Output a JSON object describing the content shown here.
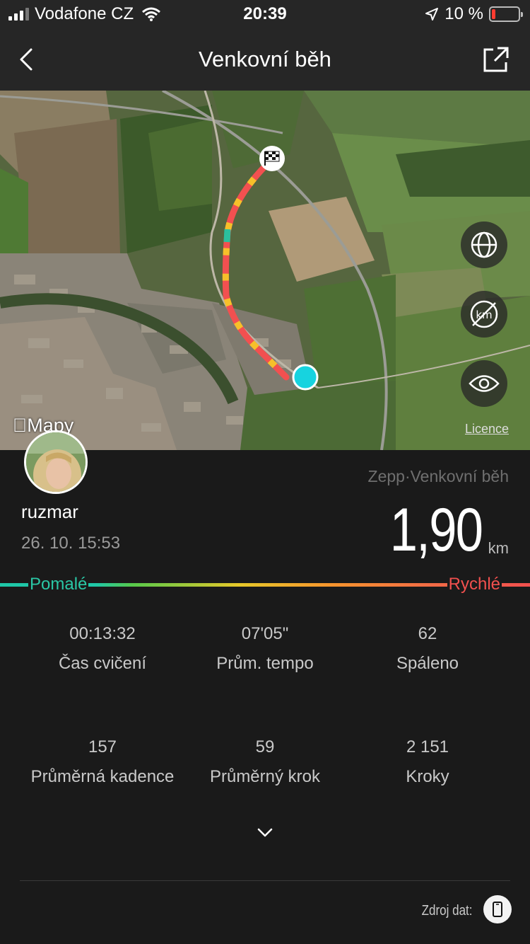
{
  "status_bar": {
    "carrier": "Vodafone CZ",
    "time": "20:39",
    "battery_text": "10 %",
    "battery_level": 0.1
  },
  "nav": {
    "title": "Venkovní běh",
    "back_icon": "chevron-left-icon",
    "share_icon": "share-icon"
  },
  "map": {
    "logo_text": "Mapy",
    "licence": "Licence",
    "buttons": [
      "globe-icon",
      "km-markers-off-icon",
      "eye-icon"
    ]
  },
  "workout": {
    "source": "Zepp·Venkovní běh",
    "user": "ruzmar",
    "date": "26. 10. 15:53",
    "distance": "1,90",
    "distance_unit": "km"
  },
  "speed_legend": {
    "slow": "Pomalé",
    "fast": "Rychlé",
    "colors": {
      "slow": "#1fc7a8",
      "mid": "#e6c82a",
      "fast": "#f2504e"
    }
  },
  "stats": [
    {
      "value": "00:13:32",
      "label": "Čas cvičení"
    },
    {
      "value": "07'05\"",
      "label": "Prům. tempo"
    },
    {
      "value": "62",
      "label": "Spáleno"
    },
    {
      "value": "157",
      "label": "Průměrná kadence"
    },
    {
      "value": "59",
      "label": "Průměrný krok"
    },
    {
      "value": "2 151",
      "label": "Kroky"
    }
  ],
  "footer": {
    "data_source_label": "Zdroj dat:",
    "device_icon": "phone-icon"
  }
}
